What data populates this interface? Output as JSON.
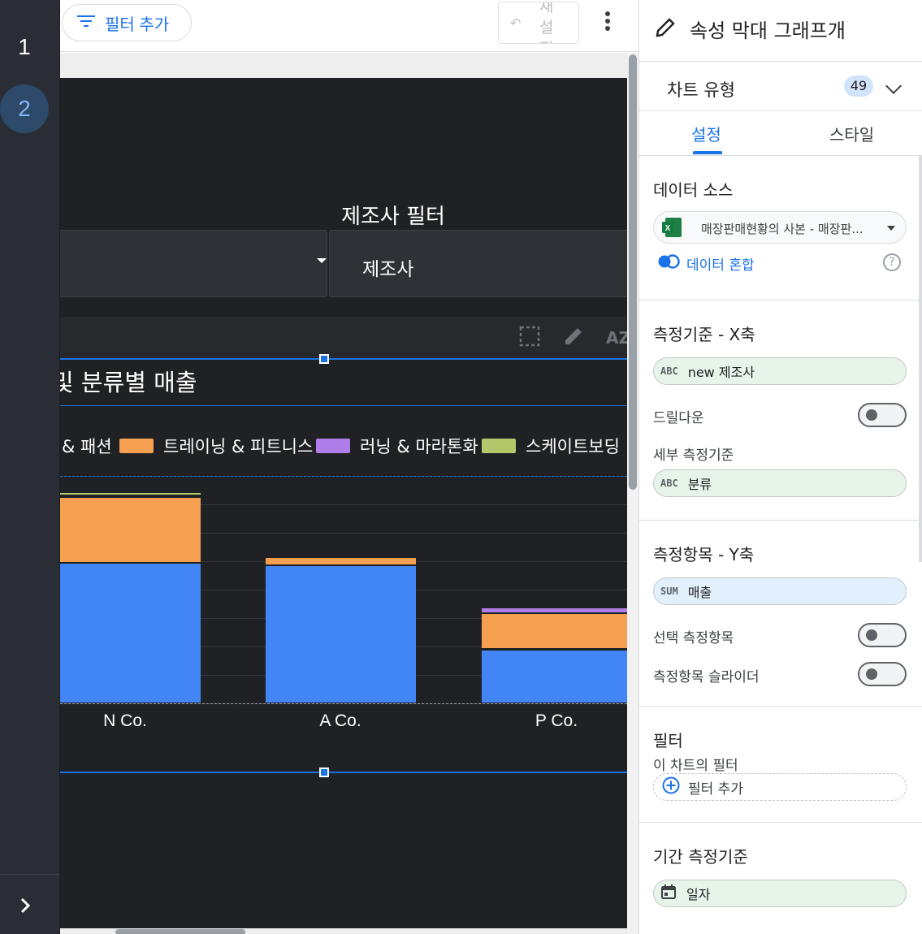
{
  "pages": [
    "1",
    "2"
  ],
  "toolbar": {
    "add_filter_label": "필터 추가",
    "reset_label": "재설정"
  },
  "report": {
    "filter_title": "제조사 필터",
    "dropdown_b_label": "제조사",
    "chart_title": "및 분류별 매출"
  },
  "chart_data": {
    "type": "bar",
    "stacked": true,
    "categories": [
      "N Co.",
      "A Co.",
      "P Co."
    ],
    "legend_position": "top",
    "series": [
      {
        "name": "& 패션",
        "color": "#4285f4",
        "values": [
          148,
          146,
          57
        ]
      },
      {
        "name": "트레이닝 & 피트니스",
        "color": "#f4a050",
        "values": [
          70,
          8,
          38
        ]
      },
      {
        "name": "러닝 & 마라톤화",
        "color": "#b07ee8",
        "values": [
          1,
          0,
          6
        ]
      },
      {
        "name": "스케이트보딩",
        "color": "#b5c76a",
        "values": [
          4,
          0,
          0
        ]
      }
    ],
    "ylim": [
      0,
      240
    ],
    "grid": true
  },
  "panel": {
    "title": "속성 막대 그래프개",
    "chart_type_label": "차트 유형",
    "chart_type_badge": "49",
    "tabs": [
      "설정",
      "스타일"
    ],
    "data_source": {
      "title": "데이터 소스",
      "name": "매장판매현황의 사본 - 매장판...",
      "blend_label": "데이터 혼합",
      "help": "?"
    },
    "dimension": {
      "title": "측정기준 - X축",
      "field_tag": "ABC",
      "field": "new 제조사",
      "drilldown_label": "드릴다운",
      "breakdown_label": "세부 측정기준",
      "breakdown_tag": "ABC",
      "breakdown_field": "분류"
    },
    "metric": {
      "title": "측정항목 - Y축",
      "field_tag": "SUM",
      "field": "매출",
      "optional_label": "선택 측정항목",
      "slider_label": "측정항목 슬라이더"
    },
    "filter": {
      "title": "필터",
      "subtitle": "이 차트의 필터",
      "add_label": "필터 추가"
    },
    "date_range": {
      "title": "기간 측정기준",
      "field": "일자"
    }
  }
}
